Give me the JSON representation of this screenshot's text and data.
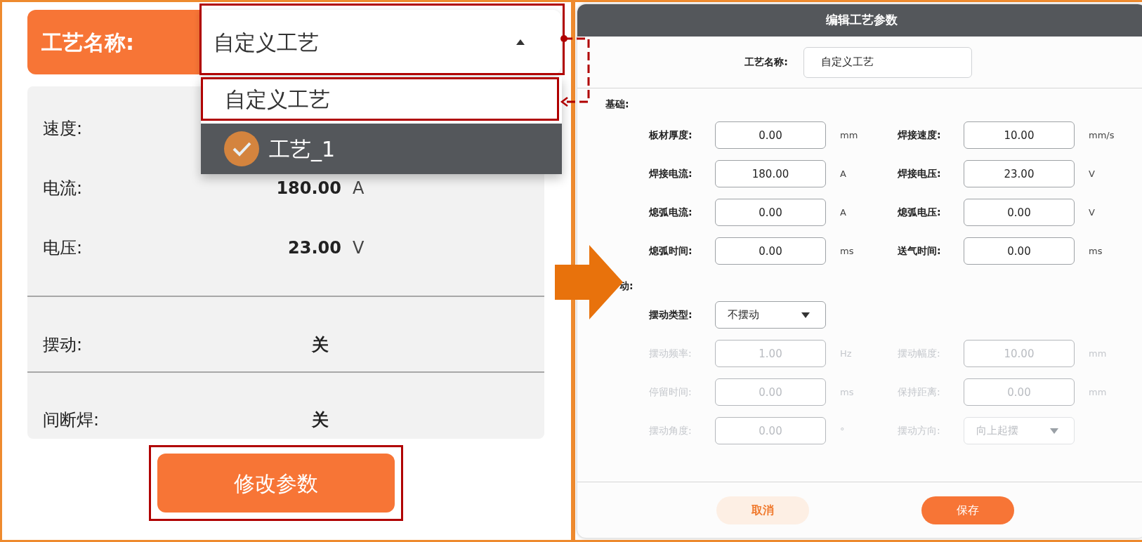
{
  "left_panel": {
    "name_label": "工艺名称:",
    "name_select": {
      "value": "自定义工艺",
      "expanded": true
    },
    "options": [
      {
        "label": "自定义工艺",
        "selected": false
      },
      {
        "label": "工艺_1",
        "selected": true
      }
    ],
    "params": [
      {
        "label": "速度:"
      },
      {
        "label": "电流:",
        "value": "180.00",
        "unit": "A"
      },
      {
        "label": "电压:",
        "value": "23.00",
        "unit": "V"
      }
    ],
    "switches": [
      {
        "label": "摆动:",
        "value": "关"
      },
      {
        "label": "间断焊:",
        "value": "关"
      }
    ],
    "edit_button": "修改参数"
  },
  "dialog": {
    "title": "编辑工艺参数",
    "name_label": "工艺名称:",
    "name_value": "自定义工艺",
    "sections": [
      {
        "label": "基础:",
        "rows": [
          [
            {
              "kind": "input",
              "label": "板材厚度:",
              "value": "0.00",
              "unit": "mm",
              "disabled": false
            },
            {
              "kind": "input",
              "label": "焊接速度:",
              "value": "10.00",
              "unit": "mm/s",
              "disabled": false
            }
          ],
          [
            {
              "kind": "input",
              "label": "焊接电流:",
              "value": "180.00",
              "unit": "A",
              "disabled": false
            },
            {
              "kind": "input",
              "label": "焊接电压:",
              "value": "23.00",
              "unit": "V",
              "disabled": false
            }
          ],
          [
            {
              "kind": "input",
              "label": "熄弧电流:",
              "value": "0.00",
              "unit": "A",
              "disabled": false
            },
            {
              "kind": "input",
              "label": "熄弧电压:",
              "value": "0.00",
              "unit": "V",
              "disabled": false
            }
          ],
          [
            {
              "kind": "input",
              "label": "熄弧时间:",
              "value": "0.00",
              "unit": "ms",
              "disabled": false
            },
            {
              "kind": "input",
              "label": "送气时间:",
              "value": "0.00",
              "unit": "ms",
              "disabled": false
            }
          ]
        ]
      },
      {
        "label": "动:",
        "rows": [
          [
            {
              "kind": "select",
              "label": "摆动类型:",
              "value": "不摆动",
              "disabled": false
            }
          ],
          [
            {
              "kind": "input",
              "label": "摆动频率:",
              "value": "1.00",
              "unit": "Hz",
              "disabled": true
            },
            {
              "kind": "input",
              "label": "摆动幅度:",
              "value": "10.00",
              "unit": "mm",
              "disabled": true
            }
          ],
          [
            {
              "kind": "input",
              "label": "停留时间:",
              "value": "0.00",
              "unit": "ms",
              "disabled": true
            },
            {
              "kind": "input",
              "label": "保持距离:",
              "value": "0.00",
              "unit": "mm",
              "disabled": true
            }
          ],
          [
            {
              "kind": "input",
              "label": "摆动角度:",
              "value": "0.00",
              "unit": "°",
              "disabled": true
            },
            {
              "kind": "select",
              "label": "摆动方向:",
              "value": "向上起摆",
              "disabled": true
            }
          ]
        ]
      }
    ],
    "buttons": [
      {
        "label": "取消",
        "kind": "secondary"
      },
      {
        "label": "保存",
        "kind": "primary"
      }
    ]
  }
}
